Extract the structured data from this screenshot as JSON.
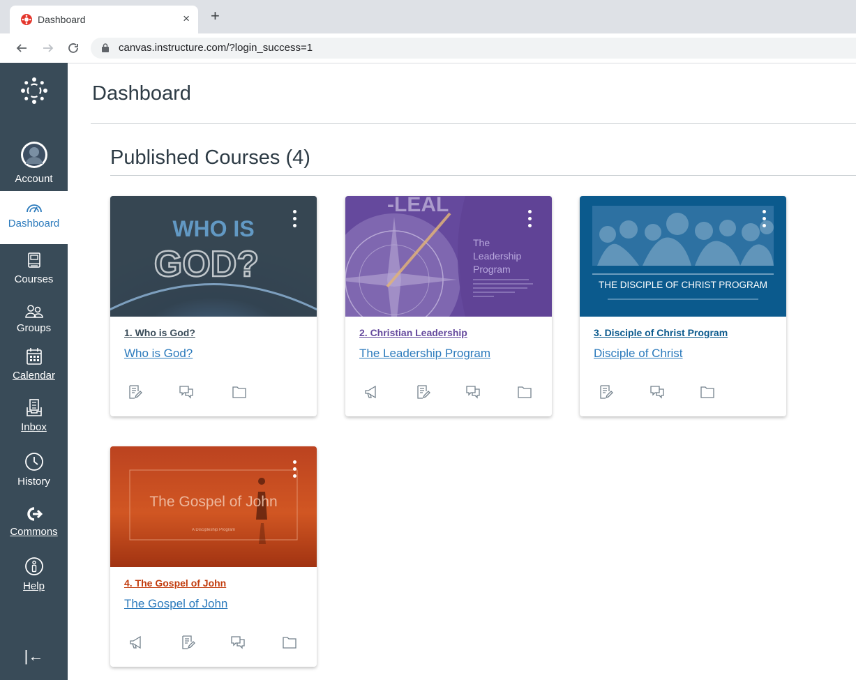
{
  "browser": {
    "tab_title": "Dashboard",
    "close_glyph": "×",
    "new_tab_glyph": "+",
    "url": "canvas.instructure.com/?login_success=1"
  },
  "nav": {
    "items": [
      {
        "label": "Account"
      },
      {
        "label": "Dashboard"
      },
      {
        "label": "Courses"
      },
      {
        "label": "Groups"
      },
      {
        "label": "Calendar"
      },
      {
        "label": "Inbox"
      },
      {
        "label": "History"
      },
      {
        "label": "Commons"
      },
      {
        "label": "Help"
      }
    ],
    "collapse_glyph": "|←"
  },
  "page": {
    "title": "Dashboard",
    "section": "Published Courses (4)"
  },
  "hero_text": {
    "who_line1": "WHO IS",
    "who_line2": "GOD?",
    "leader_logo": "-LEAL",
    "leader_l1": "The",
    "leader_l2": "Leadership",
    "leader_l3": "Program",
    "disciple_banner": "THE DISCIPLE OF CHRIST PROGRAM",
    "gospel_title": "The Gospel of John",
    "gospel_sub": "A Discipleship Program"
  },
  "courses": [
    {
      "title": "1. Who is God?",
      "subtitle": "Who is God?",
      "color": "#394b58",
      "icons": [
        "assignments-icon",
        "discussions-icon",
        "files-icon"
      ]
    },
    {
      "title": "2. Christian Leadership",
      "subtitle": "The Leadership Program",
      "color": "#65499d",
      "icons": [
        "announcements-icon",
        "assignments-icon",
        "discussions-icon",
        "files-icon"
      ]
    },
    {
      "title": "3. Disciple of Christ Program",
      "subtitle": "Disciple of Christ",
      "color": "#0b5a8d",
      "icons": [
        "assignments-icon",
        "discussions-icon",
        "files-icon"
      ]
    },
    {
      "title": "4. The Gospel of John",
      "subtitle": "The Gospel of John",
      "color": "#c23c0d",
      "icons": [
        "announcements-icon",
        "assignments-icon",
        "discussions-icon",
        "files-icon"
      ]
    }
  ],
  "colors": {
    "nav_bg": "#394b58",
    "link": "#2b7abc"
  }
}
